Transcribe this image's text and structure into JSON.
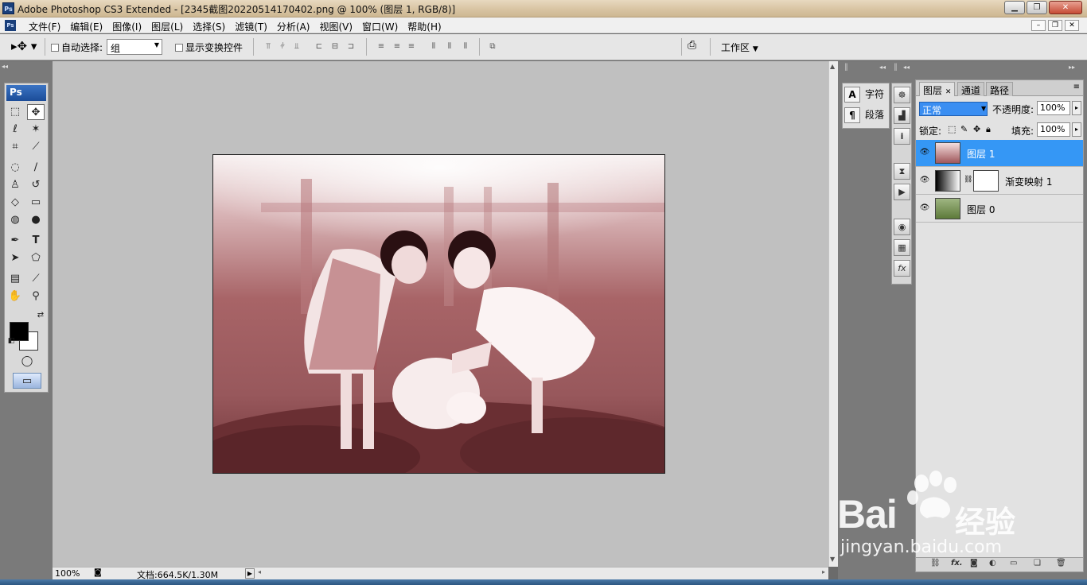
{
  "window": {
    "app_logo": "Ps",
    "title": "Adobe Photoshop CS3 Extended - [2345截图20220514170402.png @ 100% (图层 1, RGB/8)]",
    "controls": [
      "minimize-icon",
      "maximize-icon",
      "close-icon"
    ]
  },
  "menu": {
    "items": [
      "文件(F)",
      "编辑(E)",
      "图像(I)",
      "图层(L)",
      "选择(S)",
      "滤镜(T)",
      "分析(A)",
      "视图(V)",
      "窗口(W)",
      "帮助(H)"
    ]
  },
  "options": {
    "auto_select_label": "自动选择:",
    "auto_select_value": "组",
    "show_transform_label": "显示变换控件",
    "workspace_label": "工作区"
  },
  "tools": {
    "panel_title": "Ps",
    "foreground_color": "#000000",
    "background_color": "#ffffff"
  },
  "status": {
    "zoom": "100%",
    "doc_info": "文档:664.5K/1.30M"
  },
  "char_dock": {
    "character_label": "字符",
    "paragraph_label": "段落"
  },
  "layers_panel": {
    "tabs": [
      "图层",
      "通道",
      "路径"
    ],
    "blend_mode": "正常",
    "opacity_label": "不透明度:",
    "opacity_value": "100%",
    "lock_label": "锁定:",
    "fill_label": "填充:",
    "fill_value": "100%",
    "layers": [
      {
        "name": "图层 1",
        "selected": true
      },
      {
        "name": "渐变映射 1",
        "selected": false
      },
      {
        "name": "图层 0",
        "selected": false
      }
    ],
    "footer_fx": "fx."
  },
  "watermark": {
    "brand": "Bai",
    "brand_cn": "经验",
    "url": "jingyan.baidu.com"
  },
  "colors": {
    "layer_selected": "#3597f5",
    "blend_select": "#3a8ef2",
    "canvas_bg": "#c0c0c0"
  }
}
